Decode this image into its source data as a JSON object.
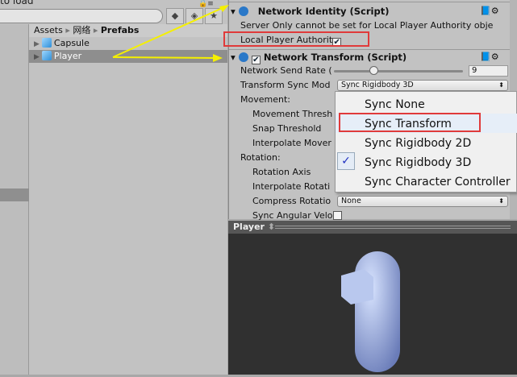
{
  "project": {
    "top_text": "to load",
    "breadcrumb": [
      "Assets",
      "网络",
      "Prefabs"
    ],
    "items": [
      {
        "name": "Capsule",
        "selected": false
      },
      {
        "name": "Player",
        "selected": true
      }
    ]
  },
  "inspector": {
    "identity": {
      "title": "Network Identity (Script)",
      "warning": "Server Only cannot be set for Local Player Authority obje",
      "local_player_authority_label": "Local Player Authorit",
      "local_player_authority": true
    },
    "transform": {
      "title": "Network Transform (Script)",
      "enabled": true,
      "send_rate_label": "Network Send Rate (",
      "send_rate": "9",
      "send_rate_fraction": 0.3,
      "sync_mode_label": "Transform Sync Mod",
      "sync_mode": "Sync Rigidbody 3D",
      "movement_label": "Movement:",
      "movement_threshold": "Movement Thresh",
      "snap_threshold": "Snap Threshold",
      "interpolate_movement": "Interpolate Mover",
      "rotation_label": "Rotation:",
      "rotation_axis": "Rotation Axis",
      "interpolate_rotation": "Interpolate Rotati",
      "compress_rotation": "Compress Rotatio",
      "compress_value": "None",
      "sync_angular": "Sync Angular Velo"
    }
  },
  "menu": {
    "options": [
      "Sync None",
      "Sync Transform",
      "Sync Rigidbody 2D",
      "Sync Rigidbody 3D",
      "Sync Character Controller"
    ],
    "checked_index": 3,
    "highlighted_index": 1
  },
  "preview": {
    "title": "Player"
  },
  "colors": {
    "annotation": "#e03a3a",
    "arrow": "#f5f000"
  }
}
